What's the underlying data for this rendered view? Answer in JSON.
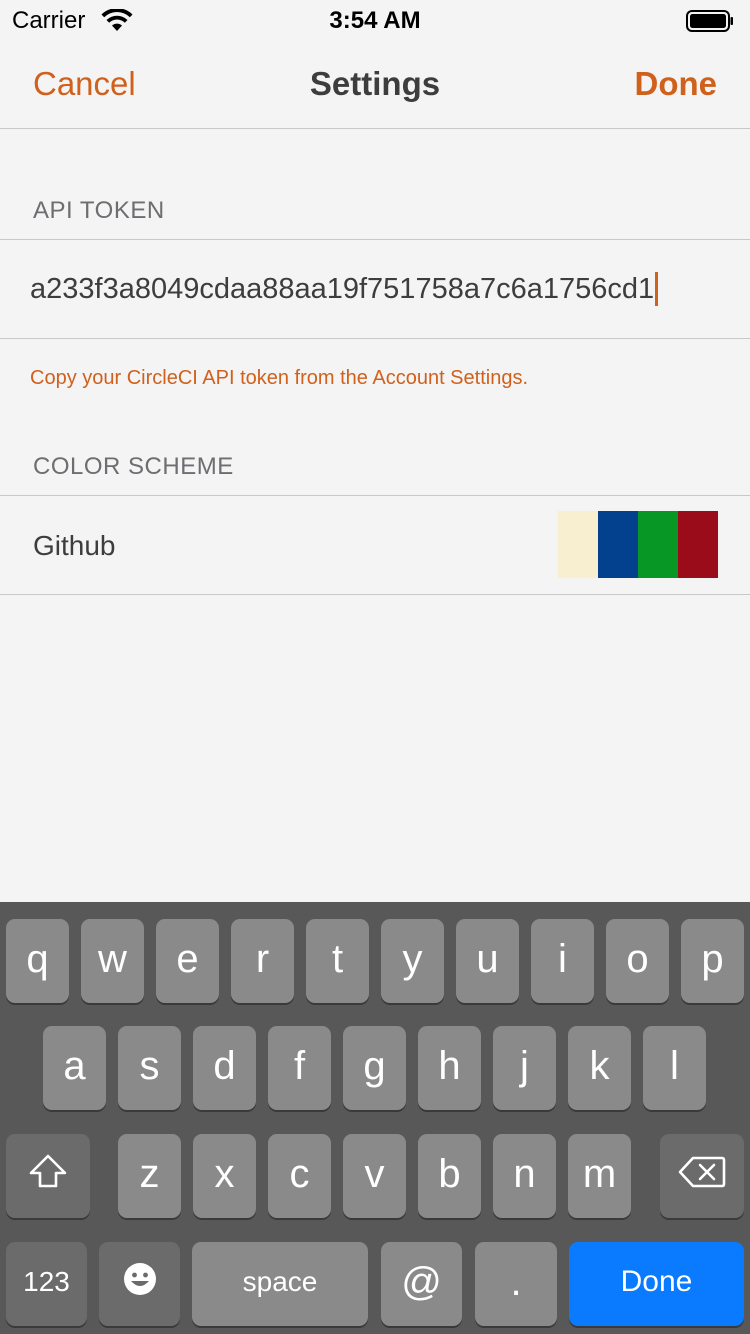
{
  "status_bar": {
    "carrier": "Carrier",
    "time": "3:54 AM"
  },
  "nav": {
    "cancel_label": "Cancel",
    "title": "Settings",
    "done_label": "Done"
  },
  "api_token": {
    "header": "API TOKEN",
    "value": "a233f3a8049cdaa88aa19f751758a7c6a1756cd1",
    "footer": "Copy your CircleCI API token from the Account Settings."
  },
  "color_scheme": {
    "header": "COLOR SCHEME",
    "name": "Github",
    "swatches": [
      "#f8eed0",
      "#03408d",
      "#069725",
      "#9a0c1a"
    ]
  },
  "keyboard": {
    "row1": [
      "q",
      "w",
      "e",
      "r",
      "t",
      "y",
      "u",
      "i",
      "o",
      "p"
    ],
    "row2": [
      "a",
      "s",
      "d",
      "f",
      "g",
      "h",
      "j",
      "k",
      "l"
    ],
    "row3": [
      "z",
      "x",
      "c",
      "v",
      "b",
      "n",
      "m"
    ],
    "numbers_label": "123",
    "space_label": "space",
    "at_label": "@",
    "period_label": ".",
    "done_label": "Done",
    "icons": {
      "shift": "shift-icon",
      "backspace": "backspace-icon",
      "emoji": "emoji-icon"
    }
  },
  "colors": {
    "accent": "#d0611c",
    "keyboard_background": "#585858",
    "key": "#8a8a8a",
    "key_dark": "#6b6b6b",
    "return_key": "#0a7aff"
  }
}
